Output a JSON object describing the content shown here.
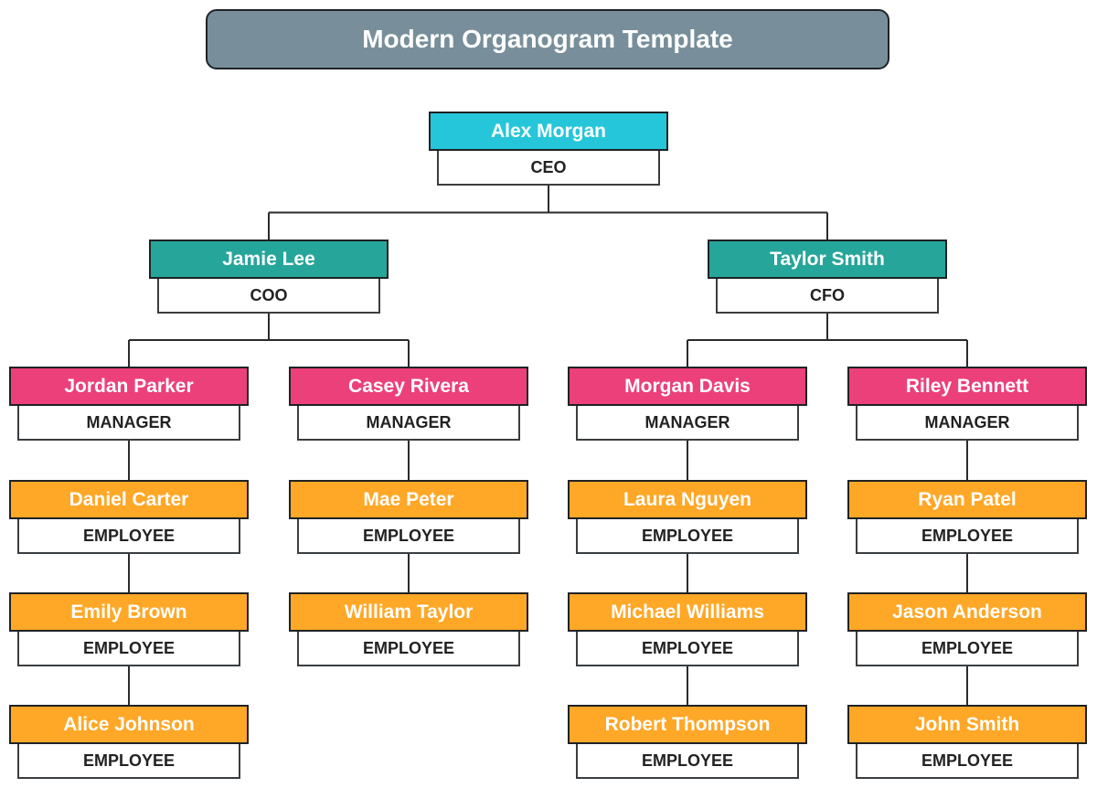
{
  "title": "Modern Organogram Template",
  "colors": {
    "ceo": "#26c6da",
    "executive": "#26a69a",
    "manager": "#ec407a",
    "employee": "#ffa726",
    "title_bg": "#788f9b",
    "line": "#2b2b2b"
  },
  "nodes": [
    {
      "id": "alex",
      "name": "Alex Morgan",
      "role": "CEO",
      "level": "ceo",
      "parent": null
    },
    {
      "id": "jamie",
      "name": "Jamie Lee",
      "role": "COO",
      "level": "executive",
      "parent": "alex"
    },
    {
      "id": "taylor",
      "name": "Taylor Smith",
      "role": "CFO",
      "level": "executive",
      "parent": "alex"
    },
    {
      "id": "jordan",
      "name": "Jordan Parker",
      "role": "MANAGER",
      "level": "manager",
      "parent": "jamie"
    },
    {
      "id": "casey",
      "name": "Casey Rivera",
      "role": "MANAGER",
      "level": "manager",
      "parent": "jamie"
    },
    {
      "id": "morgan",
      "name": "Morgan Davis",
      "role": "MANAGER",
      "level": "manager",
      "parent": "taylor"
    },
    {
      "id": "riley",
      "name": "Riley Bennett",
      "role": "MANAGER",
      "level": "manager",
      "parent": "taylor"
    },
    {
      "id": "daniel",
      "name": "Daniel Carter",
      "role": "EMPLOYEE",
      "level": "employee",
      "parent": "jordan"
    },
    {
      "id": "emily",
      "name": "Emily Brown",
      "role": "EMPLOYEE",
      "level": "employee",
      "parent": "daniel"
    },
    {
      "id": "alice",
      "name": "Alice Johnson",
      "role": "EMPLOYEE",
      "level": "employee",
      "parent": "emily"
    },
    {
      "id": "mae",
      "name": "Mae Peter",
      "role": "EMPLOYEE",
      "level": "employee",
      "parent": "casey"
    },
    {
      "id": "william",
      "name": "William Taylor",
      "role": "EMPLOYEE",
      "level": "employee",
      "parent": "mae"
    },
    {
      "id": "laura",
      "name": "Laura Nguyen",
      "role": "EMPLOYEE",
      "level": "employee",
      "parent": "morgan"
    },
    {
      "id": "michael",
      "name": "Michael Williams",
      "role": "EMPLOYEE",
      "level": "employee",
      "parent": "laura"
    },
    {
      "id": "robert",
      "name": "Robert Thompson",
      "role": "EMPLOYEE",
      "level": "employee",
      "parent": "michael"
    },
    {
      "id": "ryan",
      "name": "Ryan Patel",
      "role": "EMPLOYEE",
      "level": "employee",
      "parent": "riley"
    },
    {
      "id": "jason",
      "name": "Jason Anderson",
      "role": "EMPLOYEE",
      "level": "employee",
      "parent": "ryan"
    },
    {
      "id": "john",
      "name": "John Smith",
      "role": "EMPLOYEE",
      "level": "employee",
      "parent": "jason"
    }
  ]
}
